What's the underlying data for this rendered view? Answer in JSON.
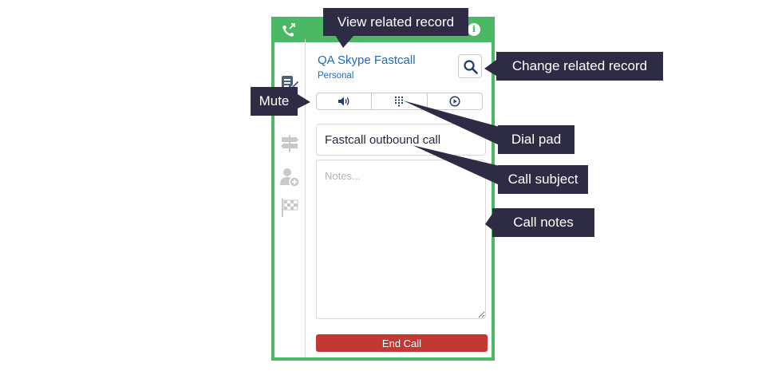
{
  "record": {
    "title": "QA Skype Fastcall",
    "subtitle": "Personal"
  },
  "subject": {
    "value": "Fastcall outbound call"
  },
  "notes": {
    "placeholder": "Notes..."
  },
  "end_call_label": "End Call",
  "callouts": {
    "view_related_record": "View related record",
    "change_related_record": "Change related record",
    "mute": "Mute",
    "dial_pad": "Dial pad",
    "call_subject": "Call subject",
    "call_notes": "Call notes"
  },
  "icons": {
    "header_left": "phone-outgoing-icon",
    "header_right": "info-icon",
    "rail": [
      "related-record-icon",
      "routing-sign-icon",
      "add-contact-icon",
      "checkered-flag-icon"
    ],
    "controls": [
      "speaker-icon",
      "dialpad-icon",
      "play-circle-icon"
    ]
  },
  "colors": {
    "accent_green": "#4bb866",
    "link_blue": "#1a6cc4",
    "danger_red": "#c23934",
    "callout_bg": "#2e2b45"
  }
}
